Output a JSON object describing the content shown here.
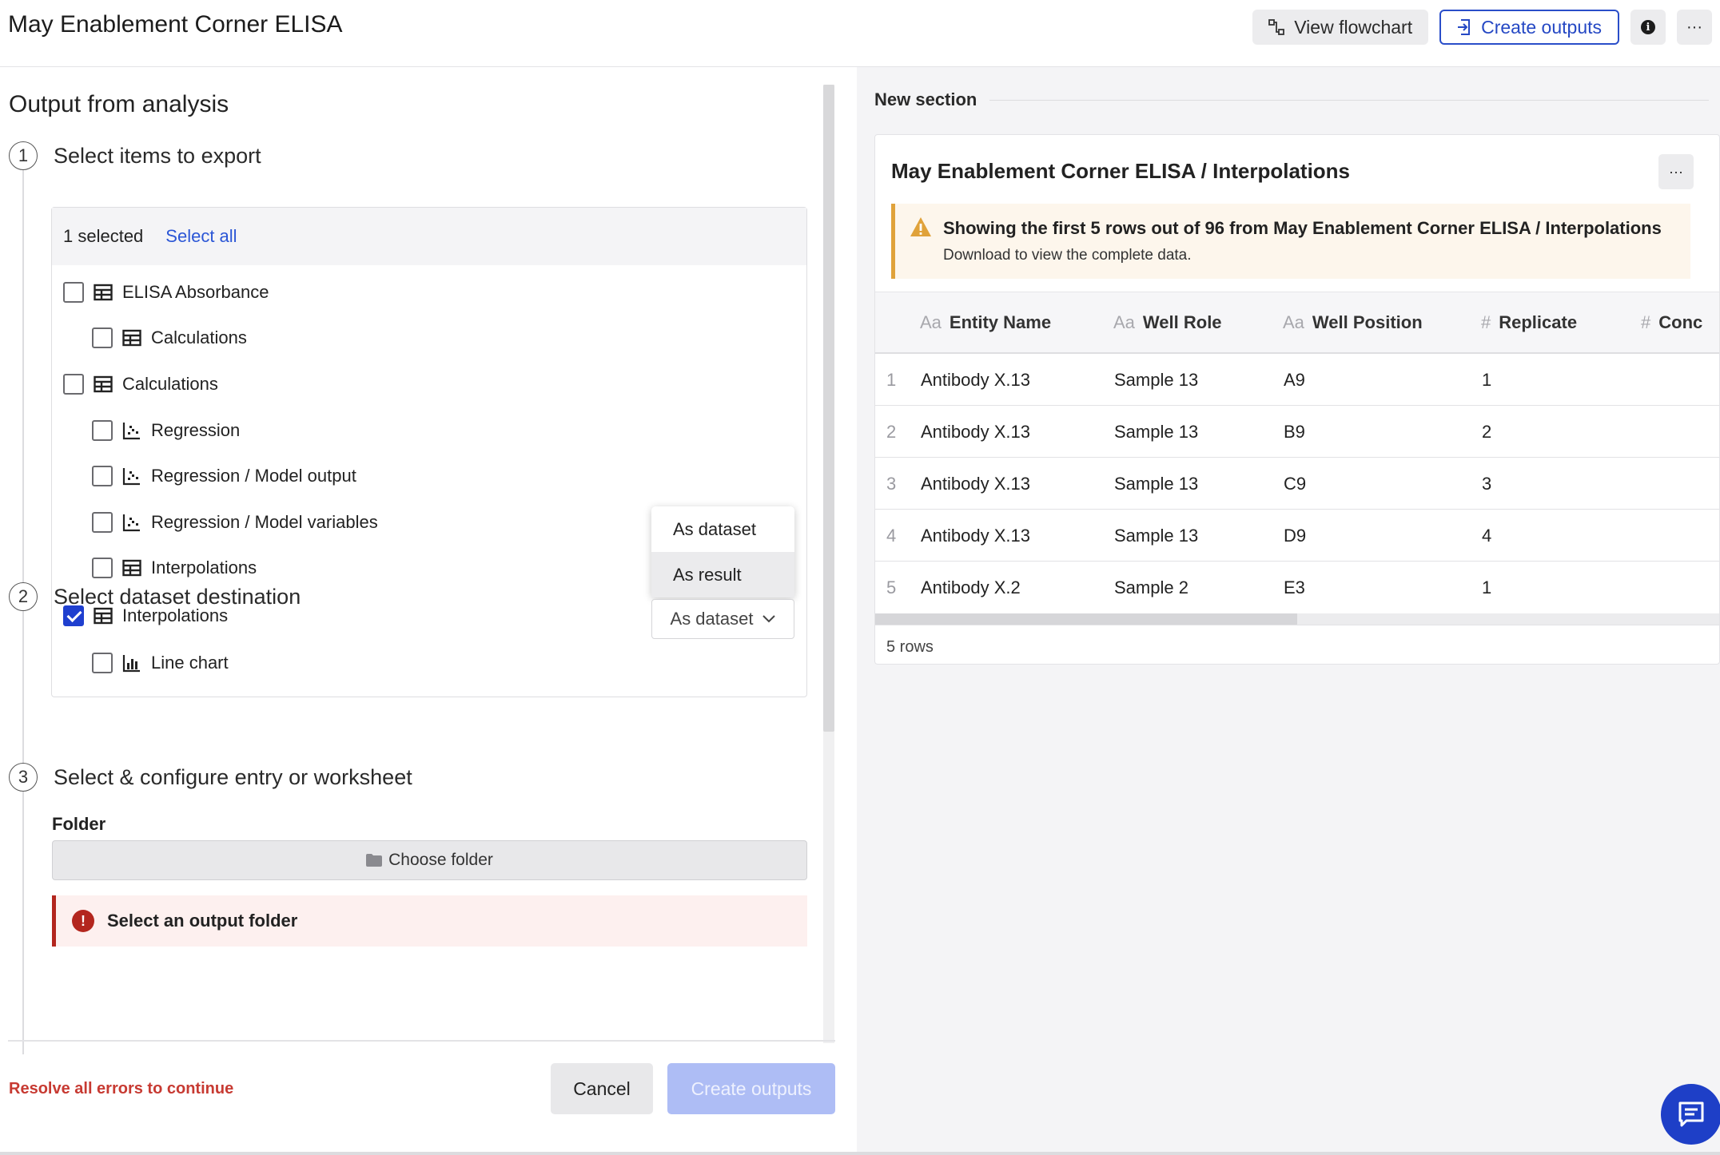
{
  "header": {
    "title": "May Enablement Corner ELISA",
    "view_flowchart": "View flowchart",
    "create_outputs": "Create outputs",
    "more": "···"
  },
  "left": {
    "section_title": "Output from analysis",
    "step1": {
      "num": "1",
      "label": "Select items to export"
    },
    "step2": {
      "num": "2",
      "label": "Select dataset destination"
    },
    "step3": {
      "num": "3",
      "label": "Select & configure entry or worksheet"
    },
    "items_head": {
      "selected": "1 selected",
      "select_all": "Select all"
    },
    "items": [
      {
        "label": "ELISA Absorbance",
        "icon": "table-icon",
        "checked": false
      },
      {
        "label": "Calculations",
        "icon": "table-icon",
        "checked": false
      },
      {
        "label": "Calculations",
        "icon": "table-icon",
        "checked": false
      },
      {
        "label": "Regression",
        "icon": "scatter-icon",
        "checked": false
      },
      {
        "label": "Regression / Model output",
        "icon": "scatter-icon",
        "checked": false
      },
      {
        "label": "Regression / Model variables",
        "icon": "scatter-icon",
        "checked": false
      },
      {
        "label": "Interpolations",
        "icon": "table-icon",
        "checked": false
      },
      {
        "label": "Interpolations",
        "icon": "table-icon",
        "checked": true
      },
      {
        "label": "Line chart",
        "icon": "bar-chart-icon",
        "checked": false
      }
    ],
    "dropdown": {
      "options": [
        "As dataset",
        "As result"
      ],
      "selected": "As dataset"
    },
    "folder": {
      "label": "Folder",
      "button": "Choose folder"
    },
    "error": "Select an output folder",
    "footer": {
      "resolve": "Resolve all errors to continue",
      "cancel": "Cancel",
      "create": "Create outputs"
    }
  },
  "right": {
    "section_title": "New section",
    "card_title": "May Enablement Corner ELISA / Interpolations",
    "card_more": "···",
    "warning": {
      "title": "Showing the first 5 rows out of 96 from May Enablement Corner ELISA / Interpolations",
      "subtitle": "Download to view the complete data."
    },
    "columns": [
      {
        "type": "Aa",
        "label": "Entity Name"
      },
      {
        "type": "Aa",
        "label": "Well Role"
      },
      {
        "type": "Aa",
        "label": "Well Position"
      },
      {
        "type": "#",
        "label": "Replicate"
      },
      {
        "type": "#",
        "label": "Conc"
      }
    ],
    "rows": [
      {
        "n": "1",
        "cells": [
          "Antibody X.13",
          "Sample 13",
          "A9",
          "1"
        ]
      },
      {
        "n": "2",
        "cells": [
          "Antibody X.13",
          "Sample 13",
          "B9",
          "2"
        ]
      },
      {
        "n": "3",
        "cells": [
          "Antibody X.13",
          "Sample 13",
          "C9",
          "3"
        ]
      },
      {
        "n": "4",
        "cells": [
          "Antibody X.13",
          "Sample 13",
          "D9",
          "4"
        ]
      },
      {
        "n": "5",
        "cells": [
          "Antibody X.2",
          "Sample 2",
          "E3",
          "1"
        ]
      }
    ],
    "footer": "5 rows"
  },
  "colors": {
    "accent": "#2548c4",
    "error": "#b3261e",
    "warning": "#e0a23a",
    "disabled_primary": "#aebdf5"
  }
}
